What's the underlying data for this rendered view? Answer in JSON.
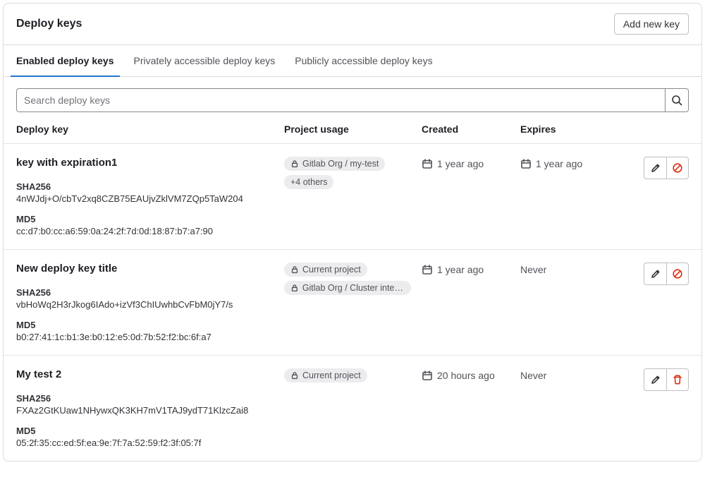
{
  "header": {
    "title": "Deploy keys",
    "add_btn": "Add new key"
  },
  "tabs": [
    {
      "label": "Enabled deploy keys",
      "active": true
    },
    {
      "label": "Privately accessible deploy keys",
      "active": false
    },
    {
      "label": "Publicly accessible deploy keys",
      "active": false
    }
  ],
  "search": {
    "placeholder": "Search deploy keys"
  },
  "columns": {
    "deploy_key": "Deploy key",
    "project_usage": "Project usage",
    "created": "Created",
    "expires": "Expires"
  },
  "labels": {
    "sha256": "SHA256",
    "md5": "MD5"
  },
  "rows": [
    {
      "title": "key with expiration1",
      "sha256": "4nWJdj+O/cbTv2xq8CZB75EAUjvZklVM7ZQp5TaW204",
      "md5": "cc:d7:b0:cc:a6:59:0a:24:2f:7d:0d:18:87:b7:a7:90",
      "badges": [
        {
          "lock": true,
          "text": "Gitlab Org / my-test"
        },
        {
          "lock": false,
          "text": "+4 others"
        }
      ],
      "created": "1 year ago",
      "expires": "1 year ago",
      "expires_has_icon": true,
      "second_action": "cancel"
    },
    {
      "title": "New deploy key title",
      "sha256": "vbHoWq2H3rJkog6IAdo+izVf3ChIUwhbCvFbM0jY7/s",
      "md5": "b0:27:41:1c:b1:3e:b0:12:e5:0d:7b:52:f2:bc:6f:a7",
      "badges": [
        {
          "lock": true,
          "text": "Current project"
        },
        {
          "lock": true,
          "text": "Gitlab Org / Cluster integ..."
        }
      ],
      "created": "1 year ago",
      "expires": "Never",
      "expires_has_icon": false,
      "second_action": "cancel"
    },
    {
      "title": "My test 2",
      "sha256": "FXAz2GtKUaw1NHywxQK3KH7mV1TAJ9ydT71KlzcZai8",
      "md5": "05:2f:35:cc:ed:5f:ea:9e:7f:7a:52:59:f2:3f:05:7f",
      "badges": [
        {
          "lock": true,
          "text": "Current project"
        }
      ],
      "created": "20 hours ago",
      "expires": "Never",
      "expires_has_icon": false,
      "second_action": "trash"
    }
  ]
}
